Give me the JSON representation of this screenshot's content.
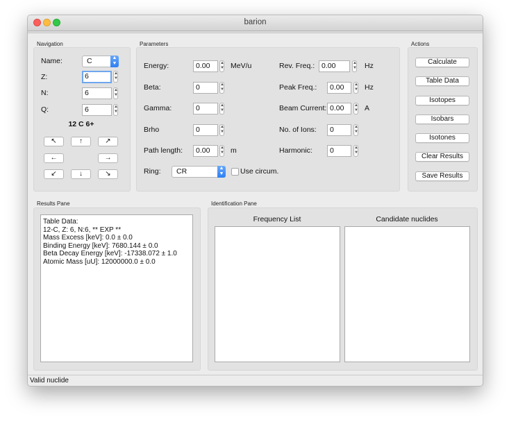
{
  "window": {
    "title": "barion"
  },
  "navigation": {
    "group_title": "Navigation",
    "name_label": "Name:",
    "name_value": "C",
    "z_label": "Z:",
    "z_value": "6",
    "n_label": "N:",
    "n_value": "6",
    "q_label": "Q:",
    "q_value": "6",
    "nuclide_text": "12 C 6+",
    "arrows": {
      "up_left": "↖",
      "up": "↑",
      "up_right": "↗",
      "left": "←",
      "right": "→",
      "down_left": "↙",
      "down": "↓",
      "down_right": "↘"
    }
  },
  "parameters": {
    "group_title": "Parameters",
    "energy_label": "Energy:",
    "energy_value": "0.00",
    "energy_unit": "MeV/u",
    "beta_label": "Beta:",
    "beta_value": "0",
    "gamma_label": "Gamma:",
    "gamma_value": "0",
    "brho_label": "Brho",
    "brho_value": "0",
    "path_label": "Path length:",
    "path_value": "0.00",
    "path_unit": "m",
    "ring_label": "Ring:",
    "ring_value": "CR",
    "use_circum_label": "Use circum.",
    "rev_freq_label": "Rev. Freq.:",
    "rev_freq_value": "0.00",
    "rev_freq_unit": "Hz",
    "peak_freq_label": "Peak Freq.:",
    "peak_freq_value": "0.00",
    "peak_freq_unit": "Hz",
    "beam_current_label": "Beam Current:",
    "beam_current_value": "0.00",
    "beam_current_unit": "A",
    "ions_label": "No. of Ions:",
    "ions_value": "0",
    "harmonic_label": "Harmonic:",
    "harmonic_value": "0"
  },
  "actions": {
    "group_title": "Actions",
    "calculate": "Calculate",
    "table_data": "Table Data",
    "isotopes": "Isotopes",
    "isobars": "Isobars",
    "isotones": "Isotones",
    "clear_results": "Clear Results",
    "save_results": "Save Results"
  },
  "results": {
    "group_title": "Results Pane",
    "lines": [
      "Table Data:",
      "12-C, Z: 6, N:6, ** EXP **",
      "Mass Excess [keV]: 0.0 ± 0.0",
      "Binding Energy [keV]: 7680.144 ± 0.0",
      "Beta Decay Energy [keV]: -17338.072 ± 1.0",
      "Atomic Mass [uU]: 12000000.0 ± 0.0"
    ]
  },
  "identification": {
    "group_title": "Identification Pane",
    "frequency_list_title": "Frequency List",
    "candidates_title": "Candidate nuclides"
  },
  "status_bar": {
    "text": "Valid nuclide"
  }
}
